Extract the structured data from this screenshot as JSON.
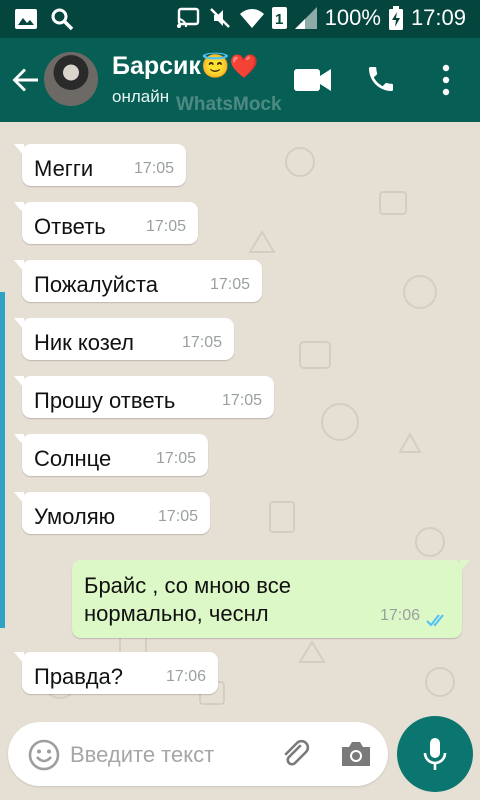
{
  "status_bar": {
    "battery": "100%",
    "time": "17:09",
    "sim_slot": "1",
    "icons": [
      "image-icon",
      "search-icon",
      "cast-icon",
      "mute-icon",
      "wifi-icon",
      "signal-icon",
      "battery-charging-icon"
    ]
  },
  "header": {
    "contact_name": "Барсик",
    "contact_emoji": "😇❤️",
    "status": "онлайн",
    "watermark": "WhatsMock",
    "icons": [
      "back-arrow-icon",
      "avatar",
      "video-call-icon",
      "phone-icon",
      "more-vert-icon"
    ]
  },
  "messages": [
    {
      "direction": "in",
      "text": "Мегги",
      "time": "17:05"
    },
    {
      "direction": "in",
      "text": "Ответь",
      "time": "17:05"
    },
    {
      "direction": "in",
      "text": "Пожалуйста",
      "time": "17:05"
    },
    {
      "direction": "in",
      "text": "Ник козел",
      "time": "17:05"
    },
    {
      "direction": "in",
      "text": "Прошу ответь",
      "time": "17:05"
    },
    {
      "direction": "in",
      "text": "Солнце",
      "time": "17:05"
    },
    {
      "direction": "in",
      "text": "Умоляю",
      "time": "17:05"
    },
    {
      "direction": "out",
      "text": "Брайс , со мною все нормально, чеснл",
      "time": "17:06",
      "status": "read"
    },
    {
      "direction": "in",
      "text": "Правда?",
      "time": "17:06"
    }
  ],
  "composer": {
    "placeholder": "Введите текст",
    "icons": [
      "emoji-icon",
      "attach-icon",
      "camera-icon",
      "mic-icon"
    ]
  },
  "colors": {
    "header": "#075e54",
    "status_bar": "#04453d",
    "chat_bg": "#e6dfd4",
    "incoming_bubble": "#ffffff",
    "outgoing_bubble": "#dcf8c6",
    "read_ticks": "#4fc3f7",
    "mic_button": "#0b766f"
  }
}
